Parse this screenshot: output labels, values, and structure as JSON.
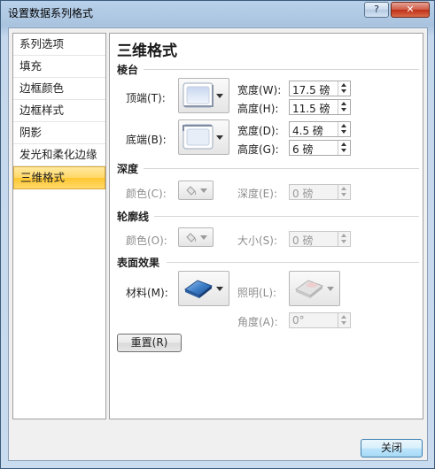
{
  "window": {
    "title": "设置数据系列格式",
    "help_label": "?",
    "close_glyph": "✕"
  },
  "sidebar": {
    "items": [
      {
        "label": "系列选项",
        "selected": false
      },
      {
        "label": "填充",
        "selected": false
      },
      {
        "label": "边框颜色",
        "selected": false
      },
      {
        "label": "边框样式",
        "selected": false
      },
      {
        "label": "阴影",
        "selected": false
      },
      {
        "label": "发光和柔化边缘",
        "selected": false
      },
      {
        "label": "三维格式",
        "selected": true
      }
    ]
  },
  "panel": {
    "title": "三维格式",
    "bevel": {
      "heading": "棱台",
      "top_label": "顶端(T):",
      "top_width_label": "宽度(W):",
      "top_width_value": "17.5 磅",
      "top_height_label": "高度(H):",
      "top_height_value": "11.5 磅",
      "bottom_label": "底端(B):",
      "bottom_width_label": "宽度(D):",
      "bottom_width_value": "4.5 磅",
      "bottom_height_label": "高度(G):",
      "bottom_height_value": "6 磅"
    },
    "depth": {
      "heading": "深度",
      "color_label": "颜色(C):",
      "depth_label": "深度(E):",
      "depth_value": "0 磅"
    },
    "contour": {
      "heading": "轮廓线",
      "color_label": "颜色(O):",
      "size_label": "大小(S):",
      "size_value": "0 磅"
    },
    "surface": {
      "heading": "表面效果",
      "material_label": "材料(M):",
      "lighting_label": "照明(L):",
      "angle_label": "角度(A):",
      "angle_value": "0°"
    },
    "reset_label": "重置(R)"
  },
  "footer": {
    "close_label": "关闭"
  },
  "colors": {
    "selected_item": "#ffd767",
    "close_button_red": "#bd3018"
  }
}
